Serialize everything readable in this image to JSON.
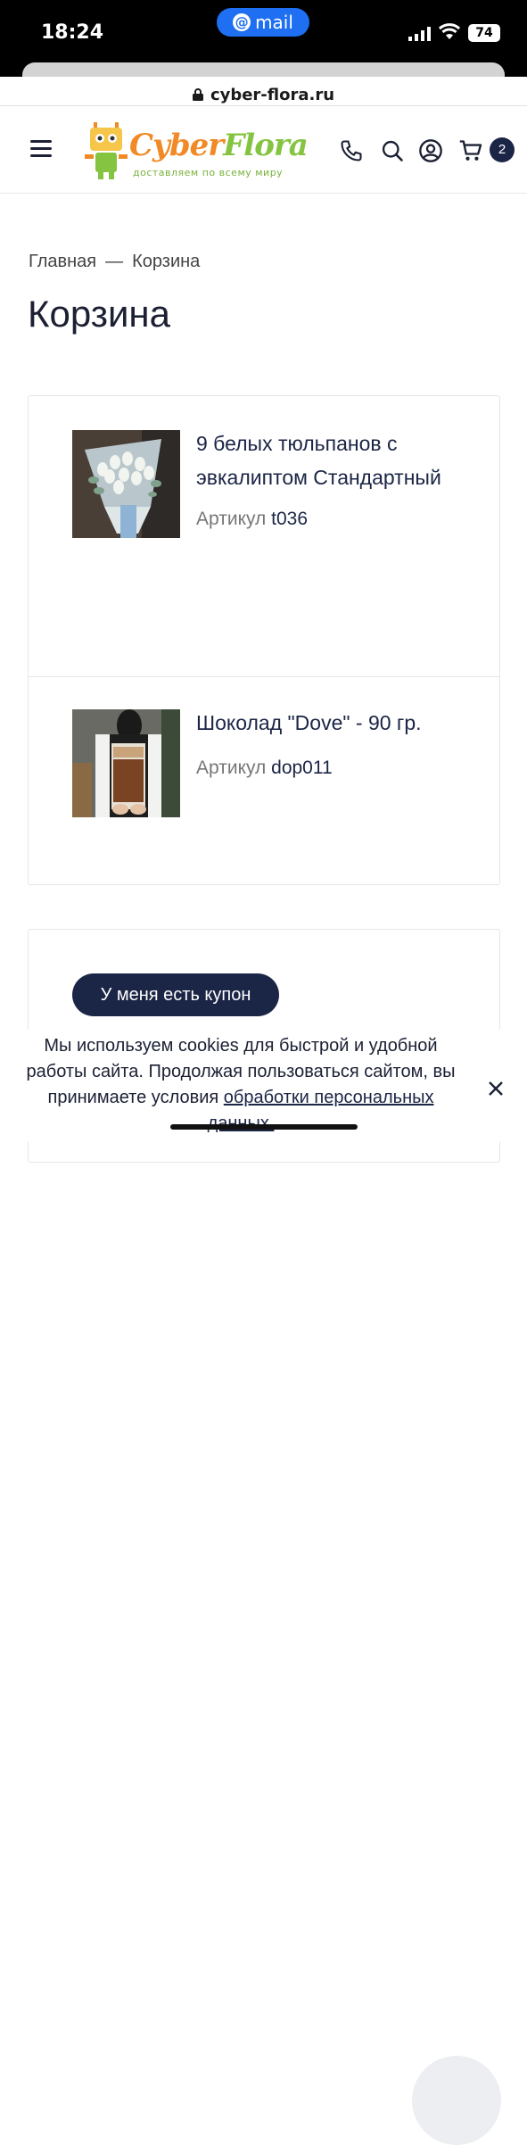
{
  "status_bar": {
    "time": "18:24",
    "mail_label": "mail",
    "battery": "74"
  },
  "browser": {
    "url": "cyber-flora.ru"
  },
  "header": {
    "logo_cyber": "Cyber",
    "logo_flora": "Flora",
    "logo_tagline": "доставляем по всему миру",
    "cart_count": "2"
  },
  "breadcrumb": {
    "home": "Главная",
    "separator": "—",
    "current": "Корзина"
  },
  "page_title": "Корзина",
  "cart": {
    "items": [
      {
        "name": "9 белых тюльпанов с эвкалиптом Стандартный",
        "sku_label": "Артикул",
        "sku": "t036"
      },
      {
        "name": "Шоколад \"Dove\" - 90 гр.",
        "sku_label": "Артикул",
        "sku": "dop011"
      }
    ]
  },
  "coupon": {
    "button_label": "У меня есть купон"
  },
  "cookie": {
    "text": "Мы используем cookies для быстрой и удобной работы сайта. Продолжая пользоваться сайтом, вы принимаете условия",
    "link": "обработки персональных данных."
  },
  "colors": {
    "accent": "#1b2545",
    "logo_green": "#84c441",
    "logo_orange": "#f18a26",
    "ios_pill": "#1e6ff2"
  }
}
